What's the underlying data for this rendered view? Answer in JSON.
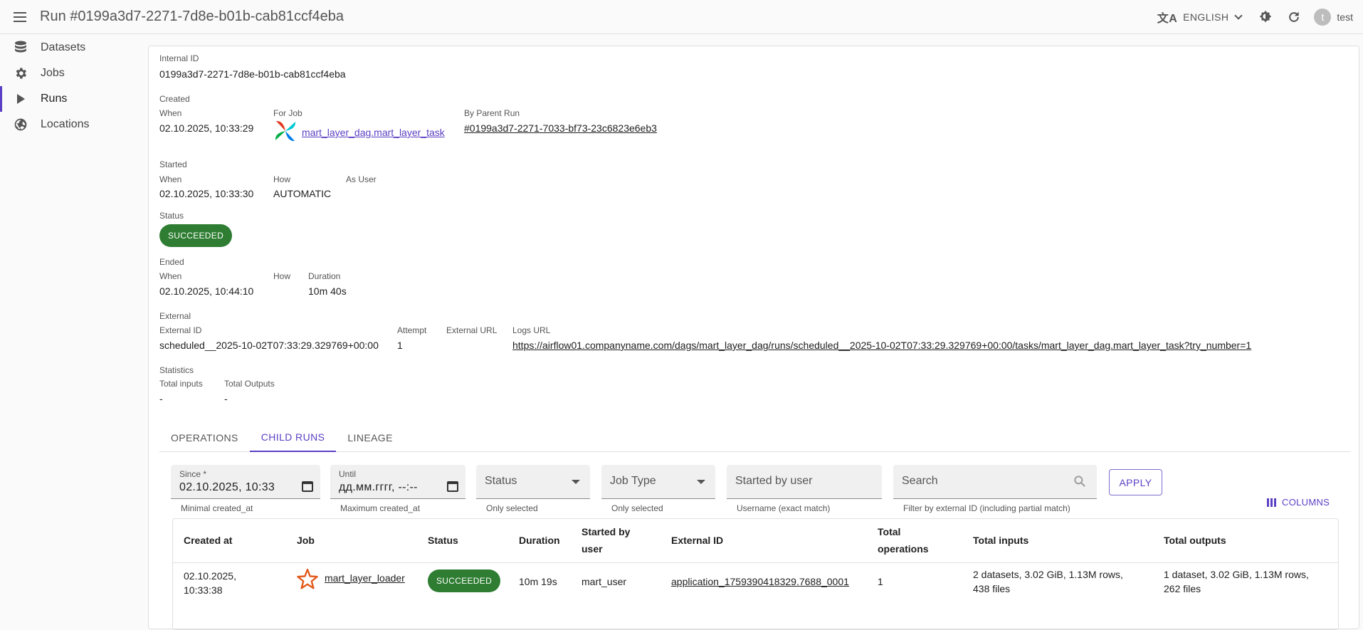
{
  "header": {
    "title": "Run #0199a3d7-2271-7d8e-b01b-cab81ccf4eba",
    "language": "ENGLISH",
    "user": "test",
    "avatar_letter": "t"
  },
  "sidebar": {
    "items": [
      {
        "label": "Datasets",
        "icon": "database-icon"
      },
      {
        "label": "Jobs",
        "icon": "gear-icon"
      },
      {
        "label": "Runs",
        "icon": "play-icon"
      },
      {
        "label": "Locations",
        "icon": "globe-icon"
      }
    ],
    "active": "Runs"
  },
  "run": {
    "internal_id_label": "Internal ID",
    "internal_id": "0199a3d7-2271-7d8e-b01b-cab81ccf4eba",
    "created": {
      "section": "Created",
      "when_label": "When",
      "when": "02.10.2025, 10:33:29",
      "for_job_label": "For Job",
      "for_job": "mart_layer_dag.mart_layer_task",
      "parent_label": "By Parent Run",
      "parent": "#0199a3d7-2271-7033-bf73-23c6823e6eb3"
    },
    "started": {
      "section": "Started",
      "when_label": "When",
      "when": "02.10.2025, 10:33:30",
      "how_label": "How",
      "how": "AUTOMATIC",
      "user_label": "As User"
    },
    "status": {
      "label": "Status",
      "value": "SUCCEEDED",
      "color": "#2e7d32"
    },
    "ended": {
      "section": "Ended",
      "when_label": "When",
      "when": "02.10.2025, 10:44:10",
      "how_label": "How",
      "duration_label": "Duration",
      "duration": "10m 40s"
    },
    "external": {
      "section": "External",
      "id_label": "External ID",
      "id": "scheduled__2025-10-02T07:33:29.329769+00:00",
      "attempt_label": "Attempt",
      "attempt": "1",
      "url_label": "External URL",
      "logs_label": "Logs URL",
      "logs": "https://airflow01.companyname.com/dags/mart_layer_dag/runs/scheduled__2025-10-02T07:33:29.329769+00:00/tasks/mart_layer_dag.mart_layer_task?try_number=1"
    },
    "statistics": {
      "section": "Statistics",
      "inputs_label": "Total inputs",
      "inputs": "-",
      "outputs_label": "Total Outputs",
      "outputs": "-"
    }
  },
  "tabs": [
    "OPERATIONS",
    "CHILD RUNS",
    "LINEAGE"
  ],
  "active_tab": "CHILD RUNS",
  "filters": {
    "since_label": "Since *",
    "since_value": "02.10.2025, 10:33",
    "since_helper": "Minimal created_at",
    "until_label": "Until",
    "until_value": "дд.мм.гггг, --:--",
    "until_helper": "Maximum created_at",
    "status_placeholder": "Status",
    "status_helper": "Only selected",
    "jobtype_placeholder": "Job Type",
    "jobtype_helper": "Only selected",
    "user_placeholder": "Started by user",
    "user_helper": "Username (exact match)",
    "search_placeholder": "Search",
    "search_helper": "Filter by external ID (including partial match)",
    "apply_label": "APPLY",
    "columns_label": "COLUMNS"
  },
  "table": {
    "headers": [
      "Created at",
      "Job",
      "Status",
      "Duration",
      "Started by user",
      "External ID",
      "Total operations",
      "Total inputs",
      "Total outputs"
    ],
    "rows": [
      {
        "created_at": "02.10.2025, 10:33:38",
        "job": "mart_layer_loader",
        "status": "SUCCEEDED",
        "duration": "10m 19s",
        "started_by": "mart_user",
        "external_id": "application_1759390418329.7688_0001",
        "total_operations": "1",
        "total_inputs": "2 datasets, 3.02 GiB, 1.13M rows, 438 files",
        "total_outputs": "1 dataset, 3.02 GiB, 1.13M rows, 262 files"
      }
    ]
  },
  "colors": {
    "accent": "#5b3fc4",
    "success": "#2e7d32"
  }
}
